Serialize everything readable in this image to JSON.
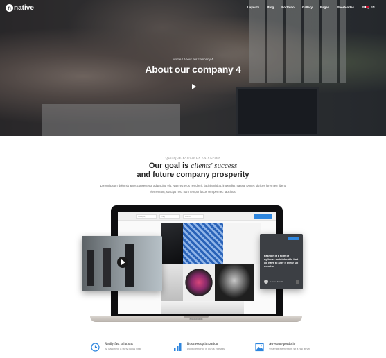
{
  "header": {
    "logo_text": "native",
    "logo_badge": "n",
    "nav": [
      "Layouts",
      "Blog",
      "Portfolio",
      "Gallery",
      "Pages",
      "Shortcodes",
      "Shop"
    ],
    "lang": "EN"
  },
  "hero": {
    "breadcrumb": "Home  /  About our company 4",
    "title": "About our company 4"
  },
  "goal": {
    "eyebrow": "QUISQUE FAUCIBUS EX SAPIEN",
    "title_line1_prefix": "Our goal is ",
    "title_line1_em": "clients' success",
    "title_line2": "and future company prosperity",
    "text": "Lorem ipsum dolor sit amet consectetur adipiscing elit. Nam eu eros hendrerit, lacinia nisl at, imperdiet massa. Donec ultrices lorem eu libero elementum, suscipit nec, nam tempor lacus semper nec faucibus."
  },
  "laptop": {
    "brand": "MoocBook",
    "fields": [
      "Category",
      "Tag",
      "Author"
    ],
    "quote": "Fashion is a form of ugliness so intolerable that we have to alter it every six months.",
    "quote_author": "Lorem Mancilla"
  },
  "features": [
    {
      "title": "Really fast solutions",
      "desc": "All handheld & fairly purus vitae",
      "icon": "clock-icon"
    },
    {
      "title": "Business optimization",
      "desc": "Donec et tortor in purus egestas",
      "icon": "bar-chart-icon"
    },
    {
      "title": "Awesome portfolio",
      "desc": "Vivamus elementum sit a nisi at vel",
      "icon": "image-icon"
    }
  ],
  "colors": {
    "accent": "#2e86de",
    "dark": "#222222"
  }
}
